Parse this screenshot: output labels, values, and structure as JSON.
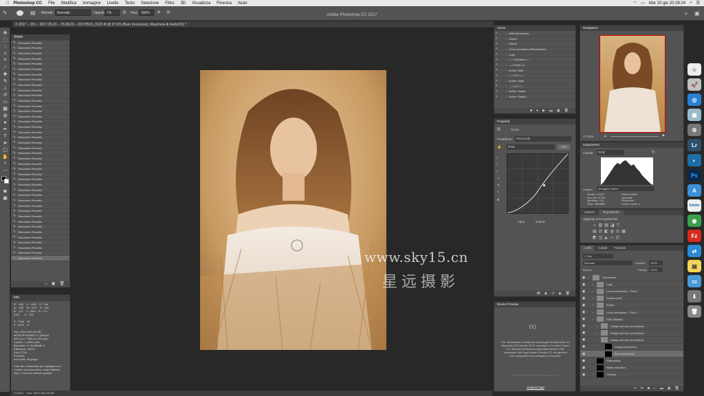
{
  "menubar": {
    "app": "Photoshop CC",
    "items": [
      "File",
      "Modifica",
      "Immagine",
      "Livello",
      "Testo",
      "Selezione",
      "Filtro",
      "3D",
      "Visualizza",
      "Finestra",
      "Aiuto"
    ],
    "clock": "Mar 20 giu  20:28:24"
  },
  "window_title": "Adobe Photoshop CC 2017",
  "options": {
    "metodo_label": "Metodo:",
    "metodo_value": "Normale",
    "opacita_label": "Opacità:",
    "opacita_value": "7%",
    "flusso_label": "Flus:",
    "flusso_value": "100%"
  },
  "doc_tab": "© 2017 – 151 – 2017.05.31 – 15.08.20 – 20170531_0122.tif @ 27,6% (Burn (recursive), Maschera di livello/16) *",
  "history": {
    "title": "Storia",
    "item_label": "Strumento Pennello",
    "count": 42
  },
  "info": {
    "title": "Info",
    "text": "R:   185    C:  18%    R:  206\nG:   150    M:  37%    G:  182\nB:   117    Y:  55%    B:  174\n8-bit       K:   0%\n\nX:  1764    W:\nY:  4075    H:\n\nDoc: 209,9 M/1,05 GB\nsRGB IEC61966-2.1 (16bpc)\n4912 px x 7360 px (300 ppi)\n1 pixel = 1,0000 pixel\nMancanti: 0 / Modificati: 0\nEfficienza: 100%*\n0,8s (77%)\nPennello\n154 livelli, 48 gruppi\n\nFate clic e trascinate per dipingere con\nil colore di primo piano. Usate Maiusc,\nOpz e Cmd per ulteriori opzioni."
  },
  "status": {
    "zoom": "27,64%",
    "doc": "Doc: 209,9 M/1,05 GB"
  },
  "watermark": {
    "line1": "www.sky15.cn",
    "line2": "星远摄影"
  },
  "actions": {
    "title": "Azioni",
    "items": [
      "D&B (Recursive)",
      "Colors",
      "Effects",
      "Final corrections (Placeholder)",
      "Logo",
      "---> Workflow <---",
      "---> Invito 2.1",
      "Action: Wild",
      "---> v3.2 <---",
      "Action: Style",
      "---> v3.2 <---",
      "Action: Oryad",
      "Action: Playful"
    ]
  },
  "properties": {
    "title": "Proprietà",
    "kind": "Curve",
    "preset_label": "Predefinito:",
    "preset_value": "Personale",
    "channel": "RGB",
    "auto_label": "Auto",
    "input_label": "Input:",
    "output_label": "Output:"
  },
  "device_preview": {
    "title": "Device Preview",
    "text": "Per visualizzare l'anteprima dei progetti direttamente sui dispositivi iOS tramite Wi-Fi, accedete a Creative Cloud. Per utilizzare Anteprima dispositivi tramite USB, accertatevi che l'app Adobe Preview CC sia aperta e che il dispositivo sia collegato al computer.",
    "link1": "Verifica la presenza di aggiornamenti",
    "link2": "Scarica l'app"
  },
  "navigator": {
    "title": "Navigatore",
    "zoom": "27,64%"
  },
  "histogram": {
    "title": "Istogramma",
    "channel_label": "Canale:",
    "channel_value": "RGB",
    "source_label": "Origine:",
    "source_value": "Immagine intera",
    "stats_left": "Media: 123,57\nDev std: 47,80\nMediana: 120\nPixel: 3864880",
    "stats_right": "Valore livello:\nQuantità:\nPercentile:\nLivello cache: 4"
  },
  "adjust": {
    "tab1": "Librerie",
    "tab2": "Regolazioni",
    "add_label": "Aggiungi una regolazione"
  },
  "layers": {
    "tabs": [
      "Livelli",
      "Canali",
      "Tracciati"
    ],
    "filter": "Tipo",
    "blend": "Normale",
    "opacity_label": "Opacità:",
    "opacity_value": "100%",
    "lock_label": "Blocca:",
    "fill_label": "Riempi:",
    "fill_value": "100%",
    "rows": [
      "Corrections",
      "Logo",
      "Local corrections – Part 2",
      "Actions pack",
      "Action",
      "Local corrections – Part 1",
      "D&B (Master)",
      "Dodge and burn (recursive)",
      "Dodge and burn (recursive)",
      "Dodge and burn (recursive)",
      "Dodge (recursive)",
      "Burn (recursive)",
      "Sharpening",
      "Noise reduction",
      "Cloning"
    ]
  },
  "dock": [
    {
      "label": "Lr",
      "color": "#2e4f6a"
    },
    {
      "label": "Ps",
      "color": "#0a2a4a"
    },
    {
      "label": "Fz",
      "color": "#d62a1e"
    }
  ]
}
